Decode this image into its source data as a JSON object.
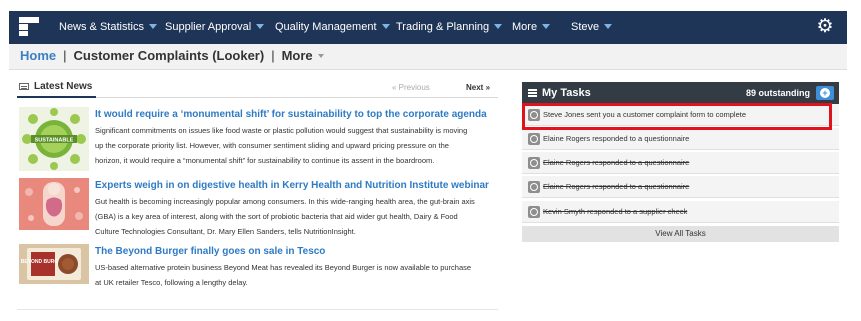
{
  "nav": {
    "items": [
      {
        "label": "News & Statistics"
      },
      {
        "label": "Supplier Approval"
      },
      {
        "label": "Quality Management"
      },
      {
        "label": "Trading & Planning"
      },
      {
        "label": "More"
      },
      {
        "label": "Steve"
      }
    ],
    "settings_icon": "gear-icon"
  },
  "breadcrumb": {
    "home": "Home",
    "separator": "|",
    "current": "Customer Complaints (Looker)",
    "more": "More"
  },
  "news": {
    "header": "Latest News",
    "previous": "« Previous",
    "next": "Next »",
    "articles": [
      {
        "title": "It would require a ‘monumental shift’ for sustainability to top the corporate agenda",
        "lines": [
          "Significant commitments on issues like food waste or plastic pollution would suggest that sustainability is moving",
          "up the corporate priority list. However, with consumer sentiment sliding and upward pricing pressure on the",
          "horizon, it would require a “monumental shift” for sustainability to continue its assent in the boardroom."
        ],
        "image_text": "SUSTAINABLE"
      },
      {
        "title": "Experts weigh in on digestive health in Kerry Health and Nutrition Institute webinar",
        "lines": [
          "Gut health is becoming increasingly popular among consumers. In this wide-ranging health area, the gut-brain axis",
          "(GBA) is a key area of interest, along with the sort of probiotic bacteria that aid wider gut health, Dairy & Food",
          "Culture Technologies Consultant, Dr. Mary Ellen Sanders, tells NutritionInsight."
        ]
      },
      {
        "title": "The Beyond Burger finally goes on sale in Tesco",
        "lines": [
          "US-based alternative protein business Beyond Meat has revealed its Beyond Burger is now available to purchase",
          "at UK retailer Tesco, following a lengthy delay."
        ],
        "image_text": "BEYOND BURGER"
      }
    ]
  },
  "tasks": {
    "title": "My Tasks",
    "count": "89 outstanding",
    "items": [
      {
        "text": "Steve Jones sent you a customer complaint form to complete",
        "done": false,
        "highlighted": true
      },
      {
        "text": "Elaine Rogers responded to a questionnaire",
        "done": false
      },
      {
        "text": "Elaine Rogers responded to a questionnaire",
        "done": true
      },
      {
        "text": "Elaine Rogers responded to a questionnaire",
        "done": true
      },
      {
        "text": "Kevin Smyth responded to a supplier check",
        "done": true
      }
    ],
    "view_all": "View All Tasks"
  },
  "colors": {
    "nav_bg": "#1e3557",
    "link_blue": "#2e7bc4",
    "tasks_header": "#333b44",
    "highlight": "#e0131d"
  }
}
